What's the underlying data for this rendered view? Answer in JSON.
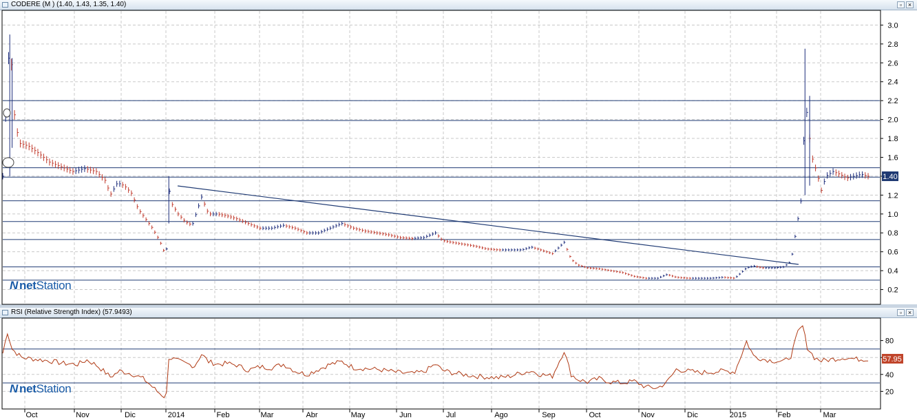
{
  "price_pane": {
    "title": "CODERE (M ) (1.40, 1.43, 1.35, 1.40)",
    "last_value_label": "1.40",
    "y_ticks": [
      "3.0",
      "2.8",
      "2.6",
      "2.4",
      "2.2",
      "2.0",
      "1.8",
      "1.6",
      "1.4",
      "1.2",
      "1.0",
      "0.8",
      "0.6",
      "0.4",
      "0.2"
    ],
    "logo": {
      "mark": "N",
      "net": "net",
      "station": "Station"
    }
  },
  "rsi_pane": {
    "title": "RSI (Relative Strength Index) (57.9493)",
    "last_value_label": "57.95",
    "y_ticks": [
      "80",
      "60",
      "40",
      "20"
    ],
    "logo": {
      "mark": "N",
      "net": "net",
      "station": "Station"
    }
  },
  "window_buttons": {
    "restore": "▫",
    "close": "×"
  },
  "x_axis": {
    "labels": [
      "Oct",
      "Nov",
      "Dic",
      "2014",
      "Feb",
      "Mar",
      "Abr",
      "May",
      "Jun",
      "Jul",
      "Ago",
      "Sep",
      "Oct",
      "Nov",
      "Dic",
      "2015",
      "Feb",
      "Mar"
    ]
  },
  "colors": {
    "up": "#1a2a7a",
    "down": "#c0392b",
    "rsi_line": "#b03a14",
    "level_line": "#1f3a73",
    "tag_blue": "#1f3a73",
    "tag_orange": "#c0442a"
  },
  "chart_data": [
    {
      "type": "bar",
      "title": "CODERE (M ) (1.40, 1.43, 1.35, 1.40)",
      "xlabel": "",
      "ylabel": "",
      "ylim": [
        0.05,
        3.1
      ],
      "grid": true,
      "ohlc_last": {
        "open": 1.4,
        "high": 1.43,
        "low": 1.35,
        "close": 1.4
      },
      "series": [
        {
          "values": [
            [
              0,
              1.4
            ],
            [
              3,
              2.9
            ],
            [
              5,
              2.05
            ],
            [
              7,
              1.75
            ],
            [
              11,
              1.72
            ],
            [
              15,
              1.65
            ],
            [
              20,
              1.55
            ],
            [
              25,
              1.5
            ],
            [
              30,
              1.45
            ],
            [
              35,
              1.48
            ],
            [
              40,
              1.45
            ],
            [
              44,
              1.35
            ],
            [
              46,
              1.2
            ],
            [
              49,
              1.33
            ],
            [
              52,
              1.3
            ],
            [
              55,
              1.22
            ],
            [
              58,
              1.05
            ],
            [
              61,
              0.95
            ],
            [
              64,
              0.85
            ],
            [
              67,
              0.72
            ],
            [
              69,
              0.6
            ],
            [
              70,
              0.63
            ],
            [
              71,
              1.28
            ],
            [
              72,
              1.12
            ],
            [
              75,
              1.0
            ],
            [
              78,
              0.92
            ],
            [
              81,
              0.88
            ],
            [
              85,
              1.18
            ],
            [
              88,
              1.0
            ],
            [
              92,
              1.0
            ],
            [
              96,
              0.98
            ],
            [
              100,
              0.95
            ],
            [
              105,
              0.9
            ],
            [
              110,
              0.85
            ],
            [
              115,
              0.85
            ],
            [
              120,
              0.88
            ],
            [
              125,
              0.85
            ],
            [
              130,
              0.8
            ],
            [
              135,
              0.8
            ],
            [
              140,
              0.85
            ],
            [
              145,
              0.9
            ],
            [
              150,
              0.85
            ],
            [
              155,
              0.82
            ],
            [
              160,
              0.8
            ],
            [
              165,
              0.78
            ],
            [
              170,
              0.75
            ],
            [
              175,
              0.74
            ],
            [
              180,
              0.75
            ],
            [
              185,
              0.8
            ],
            [
              188,
              0.72
            ],
            [
              192,
              0.7
            ],
            [
              197,
              0.68
            ],
            [
              202,
              0.66
            ],
            [
              207,
              0.63
            ],
            [
              212,
              0.62
            ],
            [
              217,
              0.62
            ],
            [
              222,
              0.62
            ],
            [
              226,
              0.65
            ],
            [
              230,
              0.62
            ],
            [
              235,
              0.58
            ],
            [
              240,
              0.7
            ],
            [
              243,
              0.52
            ],
            [
              246,
              0.46
            ],
            [
              250,
              0.43
            ],
            [
              255,
              0.42
            ],
            [
              260,
              0.4
            ],
            [
              265,
              0.38
            ],
            [
              270,
              0.34
            ],
            [
              275,
              0.32
            ],
            [
              280,
              0.32
            ],
            [
              284,
              0.36
            ],
            [
              288,
              0.33
            ],
            [
              293,
              0.32
            ],
            [
              298,
              0.32
            ],
            [
              303,
              0.32
            ],
            [
              308,
              0.33
            ],
            [
              313,
              0.32
            ],
            [
              318,
              0.43
            ],
            [
              321,
              0.45
            ],
            [
              325,
              0.43
            ],
            [
              330,
              0.43
            ],
            [
              334,
              0.44
            ],
            [
              337,
              0.5
            ],
            [
              340,
              0.95
            ],
            [
              342,
              1.25
            ],
            [
              343,
              2.3
            ],
            [
              344,
              2.0
            ],
            [
              346,
              1.6
            ],
            [
              348,
              1.45
            ],
            [
              350,
              1.25
            ],
            [
              352,
              1.4
            ],
            [
              355,
              1.45
            ],
            [
              358,
              1.42
            ],
            [
              361,
              1.38
            ],
            [
              364,
              1.4
            ],
            [
              367,
              1.42
            ],
            [
              370,
              1.4
            ]
          ]
        }
      ]
    },
    {
      "type": "line",
      "title": "RSI (Relative Strength Index) (57.9493)",
      "xlabel": "",
      "ylabel": "",
      "ylim": [
        0,
        100
      ],
      "reference_levels": [
        70,
        30
      ],
      "series": [
        {
          "values": [
            [
              0,
              65
            ],
            [
              2,
              90
            ],
            [
              4,
              70
            ],
            [
              8,
              60
            ],
            [
              14,
              58
            ],
            [
              20,
              56
            ],
            [
              26,
              53
            ],
            [
              32,
              52
            ],
            [
              36,
              57
            ],
            [
              40,
              51
            ],
            [
              44,
              42
            ],
            [
              46,
              37
            ],
            [
              50,
              44
            ],
            [
              55,
              41
            ],
            [
              60,
              35
            ],
            [
              63,
              28
            ],
            [
              66,
              20
            ],
            [
              69,
              14
            ],
            [
              70,
              17
            ],
            [
              71,
              60
            ],
            [
              74,
              57
            ],
            [
              78,
              53
            ],
            [
              82,
              50
            ],
            [
              85,
              64
            ],
            [
              88,
              55
            ],
            [
              92,
              52
            ],
            [
              96,
              53
            ],
            [
              100,
              51
            ],
            [
              105,
              45
            ],
            [
              110,
              49
            ],
            [
              115,
              48
            ],
            [
              120,
              52
            ],
            [
              125,
              44
            ],
            [
              130,
              40
            ],
            [
              135,
              46
            ],
            [
              140,
              52
            ],
            [
              145,
              55
            ],
            [
              150,
              48
            ],
            [
              155,
              47
            ],
            [
              160,
              46
            ],
            [
              165,
              44
            ],
            [
              170,
              42
            ],
            [
              175,
              41
            ],
            [
              180,
              43
            ],
            [
              185,
              52
            ],
            [
              188,
              45
            ],
            [
              192,
              42
            ],
            [
              197,
              40
            ],
            [
              202,
              38
            ],
            [
              207,
              37
            ],
            [
              212,
              36
            ],
            [
              217,
              38
            ],
            [
              222,
              42
            ],
            [
              226,
              44
            ],
            [
              230,
              40
            ],
            [
              235,
              38
            ],
            [
              240,
              68
            ],
            [
              243,
              40
            ],
            [
              246,
              34
            ],
            [
              250,
              31
            ],
            [
              255,
              35
            ],
            [
              260,
              31
            ],
            [
              265,
              30
            ],
            [
              270,
              32
            ],
            [
              275,
              25
            ],
            [
              280,
              24
            ],
            [
              284,
              31
            ],
            [
              288,
              46
            ],
            [
              293,
              44
            ],
            [
              298,
              42
            ],
            [
              303,
              43
            ],
            [
              308,
              44
            ],
            [
              313,
              43
            ],
            [
              318,
              79
            ],
            [
              321,
              62
            ],
            [
              325,
              58
            ],
            [
              330,
              56
            ],
            [
              334,
              55
            ],
            [
              337,
              62
            ],
            [
              340,
              90
            ],
            [
              342,
              97
            ],
            [
              344,
              72
            ],
            [
              347,
              60
            ],
            [
              350,
              56
            ],
            [
              355,
              58
            ],
            [
              360,
              60
            ],
            [
              365,
              58
            ],
            [
              370,
              58
            ]
          ]
        }
      ]
    }
  ]
}
